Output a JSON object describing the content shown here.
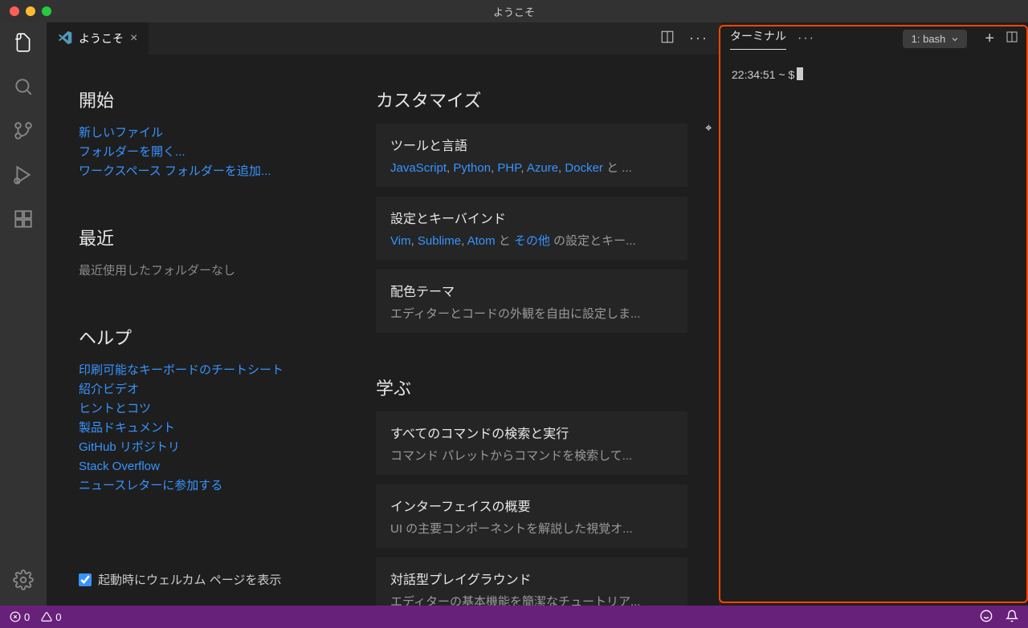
{
  "window_title": "ようこそ",
  "tab": {
    "label": "ようこそ"
  },
  "start": {
    "heading": "開始",
    "new_file": "新しいファイル",
    "open_folder": "フォルダーを開く...",
    "add_workspace": "ワークスペース フォルダーを追加..."
  },
  "recent": {
    "heading": "最近",
    "none": "最近使用したフォルダーなし"
  },
  "help": {
    "heading": "ヘルプ",
    "cheatsheet": "印刷可能なキーボードのチートシート",
    "intro_video": "紹介ビデオ",
    "tips": "ヒントとコツ",
    "docs": "製品ドキュメント",
    "github": "GitHub リポジトリ",
    "stack": "Stack Overflow",
    "newsletter": "ニュースレターに参加する"
  },
  "customize": {
    "heading": "カスタマイズ",
    "tools": {
      "title": "ツールと言語",
      "links": [
        "JavaScript",
        "Python",
        "PHP",
        "Azure",
        "Docker"
      ],
      "suffix": " と ..."
    },
    "keys": {
      "title": "設定とキーバインド",
      "links": [
        "Vim",
        "Sublime",
        "Atom"
      ],
      "mid": " と ",
      "more": "その他",
      "suffix": " の設定とキー..."
    },
    "theme": {
      "title": "配色テーマ",
      "sub": "エディターとコードの外観を自由に設定しま..."
    }
  },
  "learn": {
    "heading": "学ぶ",
    "commands": {
      "title": "すべてのコマンドの検索と実行",
      "sub": "コマンド パレットからコマンドを検索して..."
    },
    "overview": {
      "title": "インターフェイスの概要",
      "sub": "UI の主要コンポーネントを解説した視覚オ..."
    },
    "playground": {
      "title": "対話型プレイグラウンド",
      "sub": "エディターの基本機能を簡潔なチュートリア..."
    }
  },
  "startup_checkbox": "起動時にウェルカム ページを表示",
  "terminal": {
    "tab": "ターミナル",
    "select": "1: bash",
    "prompt": "22:34:51 ~ $"
  },
  "status": {
    "errors": "0",
    "warnings": "0"
  }
}
